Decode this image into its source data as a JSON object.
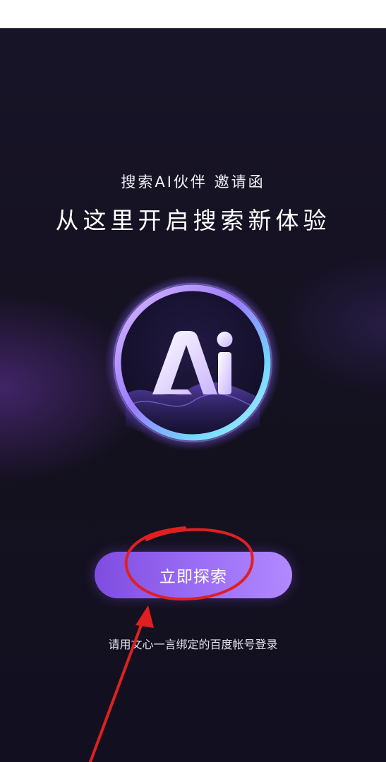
{
  "invite": {
    "subtitle": "搜索AI伙伴 邀请函",
    "headline": "从这里开启搜索新体验",
    "logo_text": "Ai"
  },
  "actions": {
    "explore_label": "立即探索"
  },
  "footer": {
    "login_hint": "请用文心一言绑定的百度帐号登录"
  },
  "colors": {
    "background": "#14111f",
    "button_start": "#7f4ce0",
    "button_end": "#b189ff",
    "annotation": "#e02020"
  },
  "icons": {
    "logo": "ai-orb-logo",
    "annotation_arrow": "red-arrow-icon",
    "annotation_circle": "red-circle-icon"
  }
}
